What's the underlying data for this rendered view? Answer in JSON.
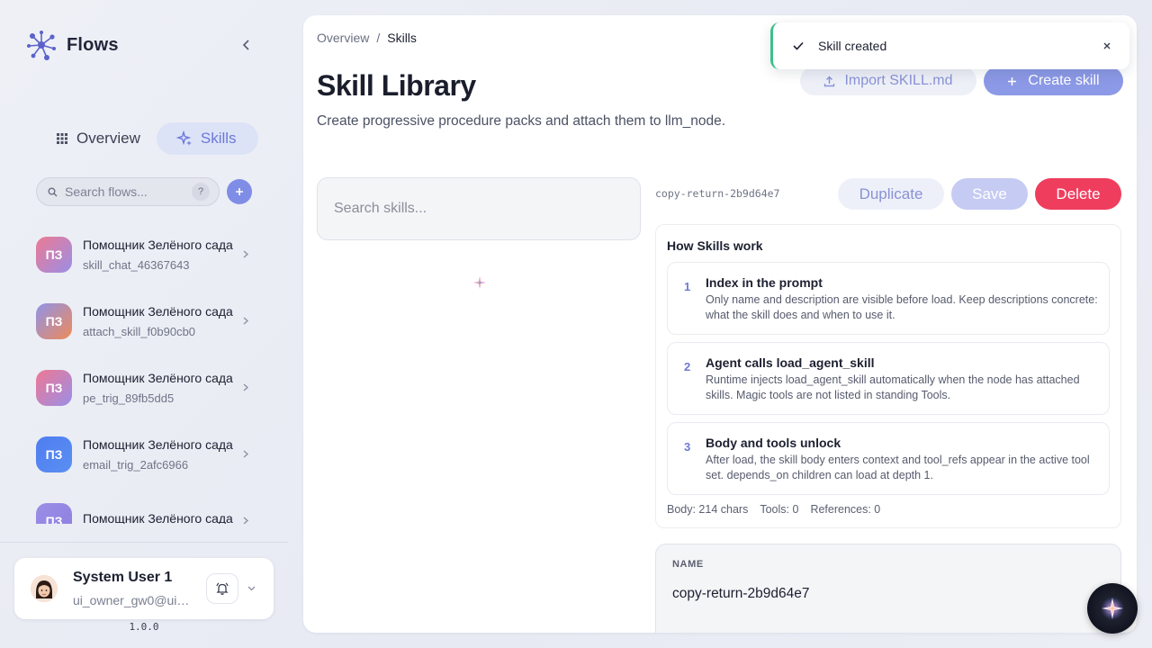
{
  "app": {
    "name": "Flows",
    "version": "1.0.0"
  },
  "nav": {
    "overview": "Overview",
    "skills": "Skills",
    "active": "skills"
  },
  "sidebar_search": {
    "placeholder": "Search flows...",
    "help": "?"
  },
  "flows": [
    {
      "initials": "ПЗ",
      "title": "Помощник Зелёного сада",
      "sub": "skill_chat_46367643",
      "color_a": "#ec7a92",
      "color_b": "#9b8ee6"
    },
    {
      "initials": "ПЗ",
      "title": "Помощник Зелёного сада",
      "sub": "attach_skill_f0b90cb0",
      "color_a": "#8f93e8",
      "color_b": "#ee8a5a"
    },
    {
      "initials": "ПЗ",
      "title": "Помощник Зелёного сада",
      "sub": "pe_trig_89fb5dd5",
      "color_a": "#ee7893",
      "color_b": "#9b8ee6"
    },
    {
      "initials": "ПЗ",
      "title": "Помощник Зелёного сада",
      "sub": "email_trig_2afc6966",
      "color_a": "#4f7df0",
      "color_b": "#5a8ff2"
    },
    {
      "initials": "ПЗ",
      "title": "Помощник Зелёного сада",
      "sub": "",
      "color_a": "#9b8ee6",
      "color_b": "#8c7fe0"
    }
  ],
  "user": {
    "name": "System User 1",
    "email": "ui_owner_gw0@ui_..."
  },
  "breadcrumb": {
    "root": "Overview",
    "sep": "/",
    "current": "Skills"
  },
  "page": {
    "title": "Skill Library",
    "description": "Create progressive procedure packs and attach them to llm_node.",
    "import_label": "Import SKILL.md",
    "create_label": "Create skill"
  },
  "skills_search": {
    "placeholder": "Search skills..."
  },
  "skill": {
    "slug": "copy-return-2b9d64e7",
    "duplicate_label": "Duplicate",
    "save_label": "Save",
    "delete_label": "Delete",
    "name_label": "NAME",
    "name_value": "copy-return-2b9d64e7"
  },
  "how": {
    "title": "How Skills work",
    "steps": [
      {
        "num": "1",
        "title": "Index in the prompt",
        "desc": "Only name and description are visible before load. Keep descriptions concrete: what the skill does and when to use it."
      },
      {
        "num": "2",
        "title": "Agent calls load_agent_skill",
        "desc": "Runtime injects load_agent_skill automatically when the node has attached skills. Magic tools are not listed in standing Tools."
      },
      {
        "num": "3",
        "title": "Body and tools unlock",
        "desc": "After load, the skill body enters context and tool_refs appear in the active tool set. depends_on children can load at depth 1."
      }
    ],
    "stats": {
      "body": "Body: 214 chars",
      "tools": "Tools: 0",
      "references": "References: 0"
    }
  },
  "toast": {
    "text": "Skill created",
    "status_color": "#3dbf8a"
  },
  "colors": {
    "accent": "#7f8de6",
    "danger": "#ef3d5e"
  }
}
